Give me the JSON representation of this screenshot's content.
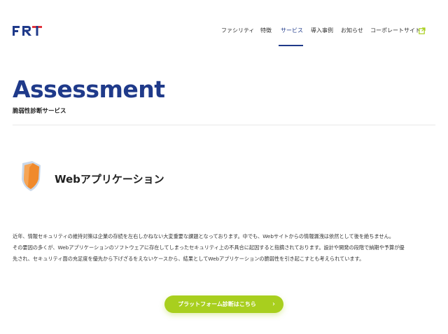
{
  "header": {
    "logo_text": "FRT",
    "nav": [
      {
        "label": "ファシリティ"
      },
      {
        "label": "特徴"
      },
      {
        "label": "サービス",
        "active": true
      },
      {
        "label": "導入事例"
      },
      {
        "label": "お知らせ"
      },
      {
        "label": "コーポレートサイト",
        "icon": "external-link-icon"
      }
    ]
  },
  "hero": {
    "title": "Assessment",
    "subtitle": "脆弱性診断サービス"
  },
  "section": {
    "icon": "shield-icon",
    "title": "Webアプリケーション",
    "paragraphs": [
      "近年、情報セキュリティの維持対策は企業の存続を左右しかねない大変重要な課題となっております。中でも、Webサイトからの情報漏洩は依然として後を絶ちません。",
      "その要因の多くが、Webアプリケーションのソフトウェアに存在してしまったセキュリティ上の不具合に起因すると指摘されております。設計や開発の段階で納期や予算が優",
      "先され、セキュリティ面の充足度を優先から下げざるをえないケースから、結果としてWebアプリケーションの脆弱性を引き起こすとも考えられています。"
    ]
  },
  "cta": {
    "label": "プラットフォーム診断はこちら",
    "arrow": "›"
  },
  "colors": {
    "brand_blue": "#1f3a8a",
    "brand_red": "#e0323c",
    "cta_green": "#a8cf1e",
    "shield_orange": "#f08a2c"
  }
}
